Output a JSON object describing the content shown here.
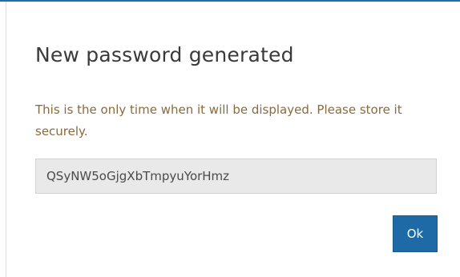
{
  "dialog": {
    "title": "New password generated",
    "message": "This is the only time when it will be displayed. Please store it securely.",
    "password_value": "QSyNW5oGjgXbTmpyuYorHmz",
    "ok_label": "Ok"
  },
  "colors": {
    "accent": "#1e6aa6",
    "message_text": "#8a6a3c",
    "field_background": "#e9e9e9"
  }
}
